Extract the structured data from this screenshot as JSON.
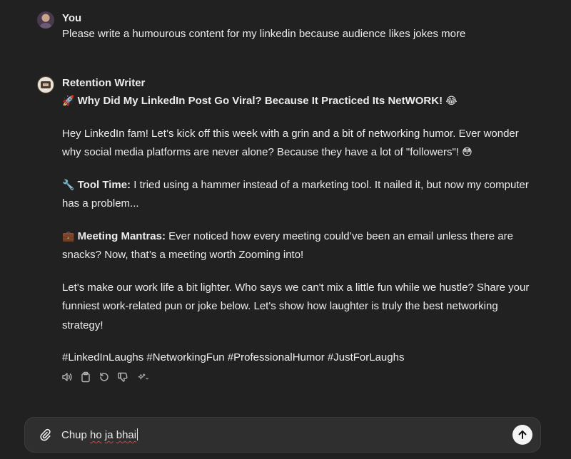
{
  "user_message": {
    "sender": "You",
    "text": "Please write a humourous content for my linkedin because audience likes jokes more"
  },
  "assistant_message": {
    "sender": "Retention Writer",
    "headline_emoji": "🚀",
    "headline": "Why Did My LinkedIn Post Go Viral? Because It Practiced Its NetWORK!",
    "headline_end_emoji": "😂",
    "intro": "Hey LinkedIn fam! Let’s kick off this week with a grin and a bit of networking humor. Ever wonder why social media platforms are never alone? Because they have a lot of \"followers\"!",
    "intro_emoji": "😳",
    "tool_emoji": "🔧",
    "tool_label": "Tool Time:",
    "tool_text": " I tried using a hammer instead of a marketing tool. It nailed it, but now my computer has a problem...",
    "meeting_emoji": "💼",
    "meeting_label": "Meeting Mantras:",
    "meeting_text": " Ever noticed how every meeting could’ve been an email unless there are snacks? Now, that’s a meeting worth Zooming into!",
    "closing": "Let's make our work life a bit lighter. Who says we can't mix a little fun while we hustle? Share your funniest work-related pun or joke below. Let's show how laughter is truly the best networking strategy!",
    "hashtags": "#LinkedInLaughs #NetworkingFun #ProfessionalHumor #JustForLaughs"
  },
  "action_icons": [
    "read-aloud-icon",
    "copy-icon",
    "regenerate-icon",
    "thumbs-down-icon",
    "sparkle-icon",
    "chevron-down-icon"
  ],
  "composer": {
    "word1": "Chup",
    "word2": "ho",
    "word3": "ja",
    "word4": "bhai"
  },
  "colors": {
    "background": "#212121",
    "composer_bg": "#2f2f2f",
    "text": "#ececec",
    "icon": "#b4b4b4"
  }
}
